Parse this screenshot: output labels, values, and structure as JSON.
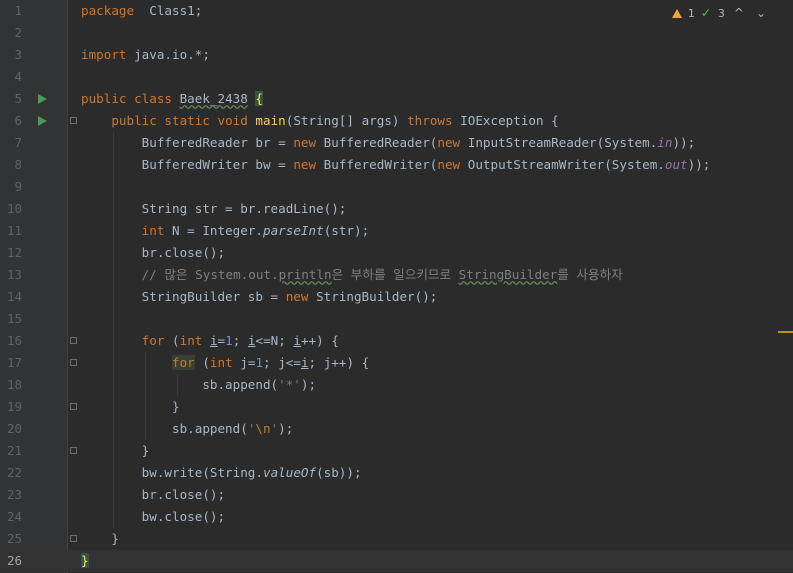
{
  "editor": {
    "inspections": {
      "warnings": "1",
      "typos": "3",
      "up_label": "^",
      "down_label": "⌄"
    },
    "lines": [
      {
        "n": "1",
        "segments": [
          [
            "kw",
            "package"
          ],
          [
            "",
            "  Class1;"
          ]
        ]
      },
      {
        "n": "2",
        "segments": []
      },
      {
        "n": "3",
        "segments": [
          [
            "kw",
            "import"
          ],
          [
            "",
            " java.io.*;"
          ]
        ]
      },
      {
        "n": "4",
        "segments": []
      },
      {
        "n": "5",
        "run": true,
        "segments": [
          [
            "kw",
            "public class "
          ],
          [
            "wavy",
            "Baek_2438"
          ],
          [
            "",
            " "
          ],
          [
            "brace-hl",
            "{"
          ]
        ]
      },
      {
        "n": "6",
        "run": true,
        "fold": true,
        "segments": [
          [
            "",
            "    "
          ],
          [
            "kw",
            "public static void "
          ],
          [
            "fn",
            "main"
          ],
          [
            "",
            "(String[] args) "
          ],
          [
            "kw",
            "throws "
          ],
          [
            "",
            "IOException {"
          ]
        ]
      },
      {
        "n": "7",
        "segments": [
          [
            "",
            "        BufferedReader br = "
          ],
          [
            "kw",
            "new "
          ],
          [
            "",
            "BufferedReader("
          ],
          [
            "kw",
            "new "
          ],
          [
            "",
            "InputStreamReader(System."
          ],
          [
            "st",
            "in"
          ],
          [
            "",
            "));"
          ]
        ]
      },
      {
        "n": "8",
        "segments": [
          [
            "",
            "        BufferedWriter bw = "
          ],
          [
            "kw",
            "new "
          ],
          [
            "",
            "BufferedWriter("
          ],
          [
            "kw",
            "new "
          ],
          [
            "",
            "OutputStreamWriter(System."
          ],
          [
            "st",
            "out"
          ],
          [
            "",
            "));"
          ]
        ]
      },
      {
        "n": "9",
        "segments": []
      },
      {
        "n": "10",
        "segments": [
          [
            "",
            "        String str = br.readLine();"
          ]
        ]
      },
      {
        "n": "11",
        "segments": [
          [
            "",
            "        "
          ],
          [
            "kw",
            "int "
          ],
          [
            "",
            "N = Integer."
          ],
          [
            "sm",
            "parseInt"
          ],
          [
            "",
            "(str);"
          ]
        ]
      },
      {
        "n": "12",
        "segments": [
          [
            "",
            "        br.close();"
          ]
        ]
      },
      {
        "n": "13",
        "segments": [
          [
            "com",
            "        // 많은 System.out."
          ],
          [
            "com wavy",
            "println"
          ],
          [
            "com",
            "은 부하를 일으키므로 "
          ],
          [
            "com wavy",
            "StringBuilder"
          ],
          [
            "com",
            "를 사용하자"
          ]
        ]
      },
      {
        "n": "14",
        "segments": [
          [
            "",
            "        StringBuilder sb = "
          ],
          [
            "kw",
            "new "
          ],
          [
            "",
            "StringBuilder();"
          ]
        ]
      },
      {
        "n": "15",
        "segments": []
      },
      {
        "n": "16",
        "fold": true,
        "segments": [
          [
            "",
            "        "
          ],
          [
            "kw",
            "for "
          ],
          [
            "",
            "("
          ],
          [
            "kw",
            "int "
          ],
          [
            "uline",
            "i"
          ],
          [
            "",
            "="
          ],
          [
            "num",
            "1"
          ],
          [
            "",
            "; "
          ],
          [
            "uline",
            "i"
          ],
          [
            "",
            "<=N; "
          ],
          [
            "uline",
            "i"
          ],
          [
            "",
            "++) {"
          ]
        ]
      },
      {
        "n": "17",
        "fold": true,
        "segments": [
          [
            "",
            "            "
          ],
          [
            "kw hl-for",
            "for"
          ],
          [
            "",
            " ("
          ],
          [
            "kw",
            "int "
          ],
          [
            "",
            "j="
          ],
          [
            "num",
            "1"
          ],
          [
            "",
            "; j<="
          ],
          [
            "uline",
            "i"
          ],
          [
            "",
            "; j++) {"
          ]
        ]
      },
      {
        "n": "18",
        "segments": [
          [
            "",
            "                sb.append("
          ],
          [
            "str",
            "'*'"
          ],
          [
            "",
            ");"
          ]
        ]
      },
      {
        "n": "19",
        "fold": true,
        "segments": [
          [
            "",
            "            }"
          ]
        ]
      },
      {
        "n": "20",
        "segments": [
          [
            "",
            "            sb.append("
          ],
          [
            "str",
            "'"
          ],
          [
            "esc",
            "\\n"
          ],
          [
            "str",
            "'"
          ],
          [
            "",
            ");"
          ]
        ]
      },
      {
        "n": "21",
        "fold": true,
        "segments": [
          [
            "",
            "        }"
          ]
        ]
      },
      {
        "n": "22",
        "segments": [
          [
            "",
            "        bw.write(String."
          ],
          [
            "sm",
            "valueOf"
          ],
          [
            "",
            "(sb));"
          ]
        ]
      },
      {
        "n": "23",
        "segments": [
          [
            "",
            "        br.close();"
          ]
        ]
      },
      {
        "n": "24",
        "segments": [
          [
            "",
            "        bw.close();"
          ]
        ]
      },
      {
        "n": "25",
        "fold": true,
        "segments": [
          [
            "",
            "    }"
          ]
        ]
      },
      {
        "n": "26",
        "current": true,
        "segments": [
          [
            "brace-hl",
            "}"
          ]
        ]
      }
    ]
  }
}
